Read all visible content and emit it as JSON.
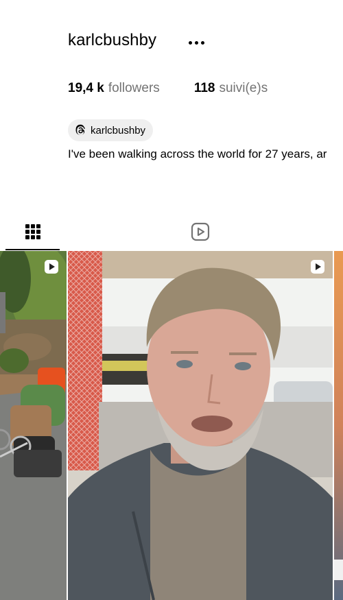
{
  "profile": {
    "username": "karlcbushby",
    "more_label": "..."
  },
  "stats": {
    "followers_count": "19,4 k",
    "followers_label": "followers",
    "following_count": "118",
    "following_label": "suivi(e)s"
  },
  "threads": {
    "handle": "karlcbushby",
    "icon": "threads-icon"
  },
  "bio": {
    "text": "I've been walking across the world for 27 years, ar"
  },
  "tabs": [
    {
      "name": "posts",
      "icon": "grid-icon",
      "active": true
    },
    {
      "name": "reels",
      "icon": "reels-icon",
      "active": false
    }
  ],
  "thumbnails": [
    {
      "subject": "roadside trolley with gear",
      "icon": "reel-icon"
    },
    {
      "subject": "man talking to camera",
      "icon": "reel-icon"
    },
    {
      "subject": "sunset",
      "icon": "none"
    }
  ],
  "colors": {
    "text": "#000000",
    "muted": "#737373",
    "badge_bg": "#efefef",
    "active_tab": "#000000"
  }
}
